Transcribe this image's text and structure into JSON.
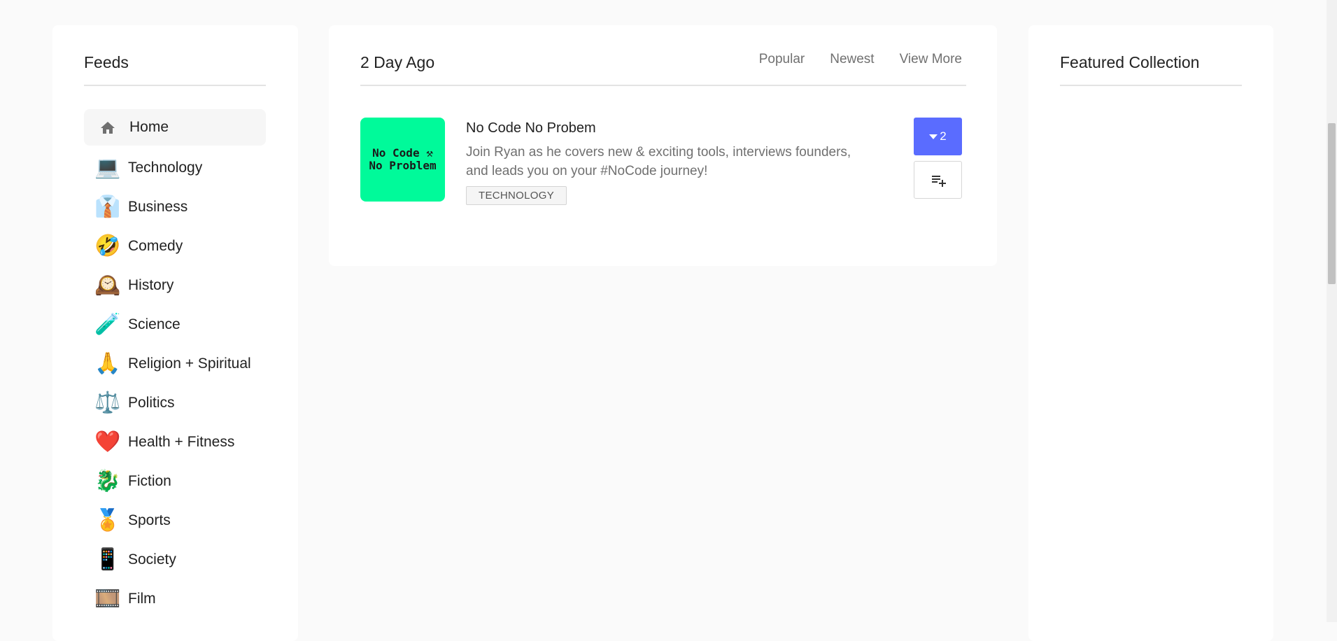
{
  "feeds": {
    "title": "Feeds",
    "items": [
      {
        "label": "Home",
        "icon": "home-icon",
        "emoji": "",
        "active": true
      },
      {
        "label": "Technology",
        "icon": "laptop-icon",
        "emoji": "💻"
      },
      {
        "label": "Business",
        "icon": "necktie-icon",
        "emoji": "👔"
      },
      {
        "label": "Comedy",
        "icon": "rolling-laughing-icon",
        "emoji": "🤣"
      },
      {
        "label": "History",
        "icon": "mantelpiece-clock-icon",
        "emoji": "🕰️"
      },
      {
        "label": "Science",
        "icon": "test-tube-icon",
        "emoji": "🧪"
      },
      {
        "label": "Religion + Spiritual",
        "icon": "folded-hands-icon",
        "emoji": "🙏"
      },
      {
        "label": "Politics",
        "icon": "balance-scale-icon",
        "emoji": "⚖️"
      },
      {
        "label": "Health + Fitness",
        "icon": "red-heart-icon",
        "emoji": "❤️"
      },
      {
        "label": "Fiction",
        "icon": "dragon-icon",
        "emoji": "🐉"
      },
      {
        "label": "Sports",
        "icon": "medal-icon",
        "emoji": "🏅"
      },
      {
        "label": "Society",
        "icon": "mobile-phone-icon",
        "emoji": "📱"
      },
      {
        "label": "Film",
        "icon": "film-frames-icon",
        "emoji": "🎞️"
      }
    ]
  },
  "main": {
    "title": "2 Day Ago",
    "tabs": [
      "Popular",
      "Newest",
      "View More"
    ],
    "podcast": {
      "cover_line1": "No Code ⚒",
      "cover_line2": "No Problem",
      "title": "No Code No Probem",
      "description": "Join Ryan as he covers new & exciting tools, interviews founders, and leads you on your #NoCode journey!",
      "tag": "TECHNOLOGY",
      "votes": "2"
    }
  },
  "featured": {
    "title": "Featured Collection"
  },
  "colors": {
    "accent": "#5a6cff",
    "cover": "#00fa9a",
    "background": "#fafafa"
  }
}
